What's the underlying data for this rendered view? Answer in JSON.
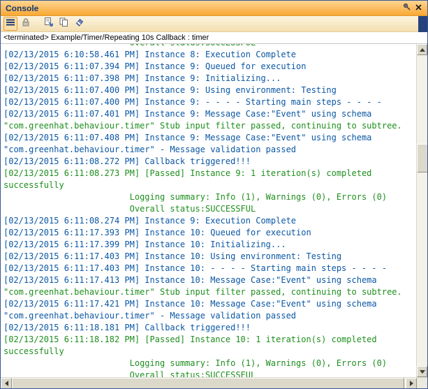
{
  "window": {
    "title": "Console"
  },
  "toolbar": {
    "buttons": [
      {
        "id": "menu",
        "icon": "hamburger-icon",
        "selected": true
      },
      {
        "id": "scroll-lock",
        "icon": "lock-icon",
        "selected": false
      },
      {
        "id": "export",
        "icon": "export-icon",
        "selected": false
      },
      {
        "id": "copy",
        "icon": "copy-icon",
        "selected": false
      },
      {
        "id": "clear",
        "icon": "eraser-icon",
        "selected": false
      }
    ]
  },
  "status_line": "<terminated> Example/Timer/Repeating 10s Callback : timer",
  "icons": {
    "hamburger-icon": "≡",
    "lock-icon": "🔒",
    "export-icon": "⇲",
    "copy-icon": "⧉",
    "eraser-icon": "⌫",
    "pin-icon": "📌",
    "close-icon": "✕",
    "scroll-up-icon": "▲",
    "scroll-down-icon": "▼",
    "scroll-left-icon": "◀",
    "scroll-right-icon": "▶"
  },
  "colors": {
    "titlebar_orange": "#F9A833",
    "toolbar_cream": "#F6E6C2",
    "edge_navy": "#26437C",
    "console_info_blue": "#0B57A4",
    "console_success_green": "#1E8E1E"
  },
  "console": {
    "lines": [
      {
        "color": "success",
        "partial": true,
        "text": "                         Overall status:SUCCESSFUL"
      },
      {
        "color": "info",
        "text": "[02/13/2015 6:10:58.461 PM] Instance 8: Execution Complete"
      },
      {
        "color": "info",
        "text": "[02/13/2015 6:11:07.394 PM] Instance 9: Queued for execution"
      },
      {
        "color": "info",
        "text": "[02/13/2015 6:11:07.398 PM] Instance 9: Initializing..."
      },
      {
        "color": "info",
        "text": "[02/13/2015 6:11:07.400 PM] Instance 9: Using environment: Testing"
      },
      {
        "color": "info",
        "text": "[02/13/2015 6:11:07.400 PM] Instance 9: - - - - Starting main steps - - - -"
      },
      {
        "color": "info",
        "text": "[02/13/2015 6:11:07.401 PM] Instance 9: Message Case:\"Event\" using schema"
      },
      {
        "color": "success",
        "text": "\"com.greenhat.behaviour.timer\" Stub input filter passed, continuing to subtree."
      },
      {
        "color": "info",
        "text": "[02/13/2015 6:11:07.408 PM] Instance 9: Message Case:\"Event\" using schema"
      },
      {
        "color": "info",
        "text": "\"com.greenhat.behaviour.timer\" - Message validation passed"
      },
      {
        "color": "info",
        "text": "[02/13/2015 6:11:08.272 PM] Callback triggered!!!"
      },
      {
        "color": "success",
        "text": "[02/13/2015 6:11:08.273 PM] [Passed] Instance 9: 1 iteration(s) completed"
      },
      {
        "color": "success",
        "text": "successfully"
      },
      {
        "color": "success",
        "text": "                         Logging summary: Info (1), Warnings (0), Errors (0)"
      },
      {
        "color": "success",
        "text": "                         Overall status:SUCCESSFUL"
      },
      {
        "color": "info",
        "text": "[02/13/2015 6:11:08.274 PM] Instance 9: Execution Complete"
      },
      {
        "color": "info",
        "text": "[02/13/2015 6:11:17.393 PM] Instance 10: Queued for execution"
      },
      {
        "color": "info",
        "text": "[02/13/2015 6:11:17.399 PM] Instance 10: Initializing..."
      },
      {
        "color": "info",
        "text": "[02/13/2015 6:11:17.403 PM] Instance 10: Using environment: Testing"
      },
      {
        "color": "info",
        "text": "[02/13/2015 6:11:17.403 PM] Instance 10: - - - - Starting main steps - - - -"
      },
      {
        "color": "info",
        "text": "[02/13/2015 6:11:17.413 PM] Instance 10: Message Case:\"Event\" using schema"
      },
      {
        "color": "success",
        "text": "\"com.greenhat.behaviour.timer\" Stub input filter passed, continuing to subtree."
      },
      {
        "color": "info",
        "text": "[02/13/2015 6:11:17.421 PM] Instance 10: Message Case:\"Event\" using schema"
      },
      {
        "color": "info",
        "text": "\"com.greenhat.behaviour.timer\" - Message validation passed"
      },
      {
        "color": "info",
        "text": "[02/13/2015 6:11:18.181 PM] Callback triggered!!!"
      },
      {
        "color": "success",
        "text": "[02/13/2015 6:11:18.182 PM] [Passed] Instance 10: 1 iteration(s) completed"
      },
      {
        "color": "success",
        "text": "successfully"
      },
      {
        "color": "success",
        "text": "                         Logging summary: Info (1), Warnings (0), Errors (0)"
      },
      {
        "color": "success",
        "text": "                         Overall status:SUCCESSFUL"
      }
    ]
  }
}
